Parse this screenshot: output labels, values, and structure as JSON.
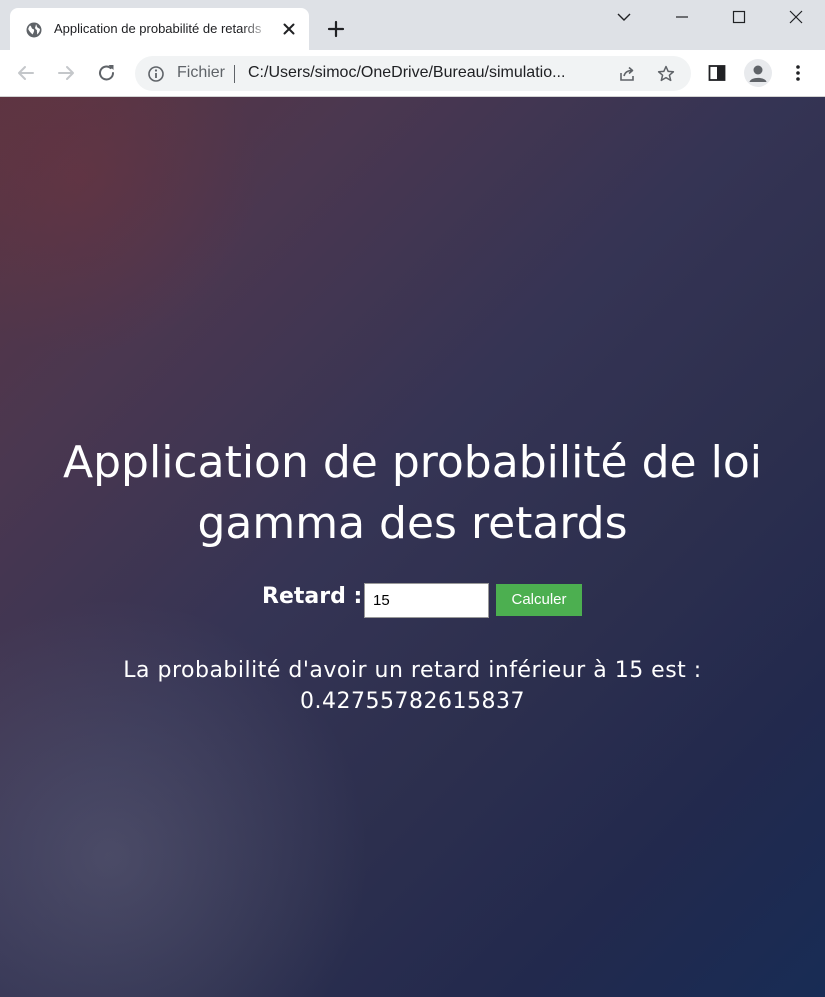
{
  "browser": {
    "tab": {
      "title": "Application de probabilité de retards"
    },
    "address_bar": {
      "scheme_label": "Fichier",
      "url": "C:/Users/simoc/OneDrive/Bureau/simulatio..."
    }
  },
  "page": {
    "heading_line1": "Application de probabilité de loi",
    "heading_line2": "gamma des retards",
    "form": {
      "label": "Retard :",
      "input_value": "15",
      "button_label": "Calculer"
    },
    "result_line1": "La probabilité d'avoir un retard inférieur à 15 est :",
    "result_line2": "0.42755782615837"
  },
  "colors": {
    "button_bg": "#4caf50",
    "text": "#ffffff"
  }
}
